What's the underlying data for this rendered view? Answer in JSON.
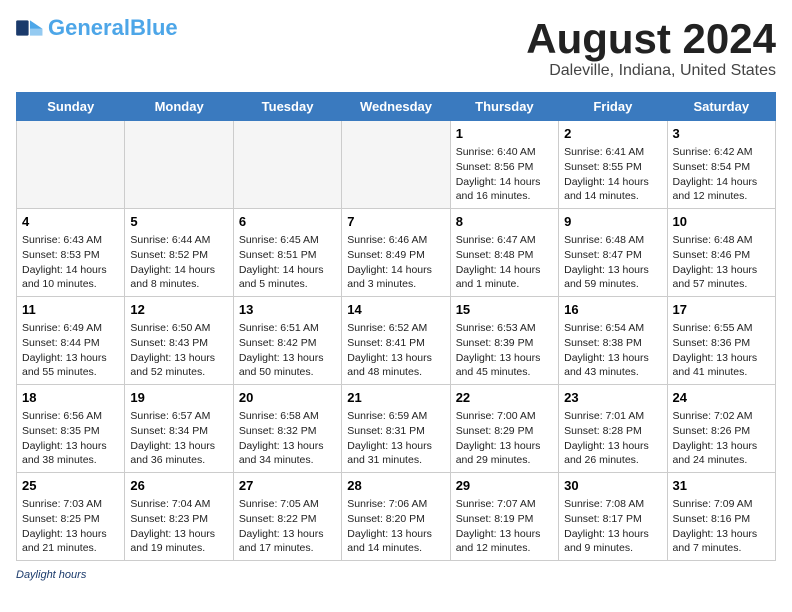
{
  "header": {
    "logo_line1": "General",
    "logo_line2": "Blue",
    "title": "August 2024",
    "subtitle": "Daleville, Indiana, United States"
  },
  "days_of_week": [
    "Sunday",
    "Monday",
    "Tuesday",
    "Wednesday",
    "Thursday",
    "Friday",
    "Saturday"
  ],
  "weeks": [
    [
      {
        "day": "",
        "info": ""
      },
      {
        "day": "",
        "info": ""
      },
      {
        "day": "",
        "info": ""
      },
      {
        "day": "",
        "info": ""
      },
      {
        "day": "1",
        "info": "Sunrise: 6:40 AM\nSunset: 8:56 PM\nDaylight: 14 hours and 16 minutes."
      },
      {
        "day": "2",
        "info": "Sunrise: 6:41 AM\nSunset: 8:55 PM\nDaylight: 14 hours and 14 minutes."
      },
      {
        "day": "3",
        "info": "Sunrise: 6:42 AM\nSunset: 8:54 PM\nDaylight: 14 hours and 12 minutes."
      }
    ],
    [
      {
        "day": "4",
        "info": "Sunrise: 6:43 AM\nSunset: 8:53 PM\nDaylight: 14 hours and 10 minutes."
      },
      {
        "day": "5",
        "info": "Sunrise: 6:44 AM\nSunset: 8:52 PM\nDaylight: 14 hours and 8 minutes."
      },
      {
        "day": "6",
        "info": "Sunrise: 6:45 AM\nSunset: 8:51 PM\nDaylight: 14 hours and 5 minutes."
      },
      {
        "day": "7",
        "info": "Sunrise: 6:46 AM\nSunset: 8:49 PM\nDaylight: 14 hours and 3 minutes."
      },
      {
        "day": "8",
        "info": "Sunrise: 6:47 AM\nSunset: 8:48 PM\nDaylight: 14 hours and 1 minute."
      },
      {
        "day": "9",
        "info": "Sunrise: 6:48 AM\nSunset: 8:47 PM\nDaylight: 13 hours and 59 minutes."
      },
      {
        "day": "10",
        "info": "Sunrise: 6:48 AM\nSunset: 8:46 PM\nDaylight: 13 hours and 57 minutes."
      }
    ],
    [
      {
        "day": "11",
        "info": "Sunrise: 6:49 AM\nSunset: 8:44 PM\nDaylight: 13 hours and 55 minutes."
      },
      {
        "day": "12",
        "info": "Sunrise: 6:50 AM\nSunset: 8:43 PM\nDaylight: 13 hours and 52 minutes."
      },
      {
        "day": "13",
        "info": "Sunrise: 6:51 AM\nSunset: 8:42 PM\nDaylight: 13 hours and 50 minutes."
      },
      {
        "day": "14",
        "info": "Sunrise: 6:52 AM\nSunset: 8:41 PM\nDaylight: 13 hours and 48 minutes."
      },
      {
        "day": "15",
        "info": "Sunrise: 6:53 AM\nSunset: 8:39 PM\nDaylight: 13 hours and 45 minutes."
      },
      {
        "day": "16",
        "info": "Sunrise: 6:54 AM\nSunset: 8:38 PM\nDaylight: 13 hours and 43 minutes."
      },
      {
        "day": "17",
        "info": "Sunrise: 6:55 AM\nSunset: 8:36 PM\nDaylight: 13 hours and 41 minutes."
      }
    ],
    [
      {
        "day": "18",
        "info": "Sunrise: 6:56 AM\nSunset: 8:35 PM\nDaylight: 13 hours and 38 minutes."
      },
      {
        "day": "19",
        "info": "Sunrise: 6:57 AM\nSunset: 8:34 PM\nDaylight: 13 hours and 36 minutes."
      },
      {
        "day": "20",
        "info": "Sunrise: 6:58 AM\nSunset: 8:32 PM\nDaylight: 13 hours and 34 minutes."
      },
      {
        "day": "21",
        "info": "Sunrise: 6:59 AM\nSunset: 8:31 PM\nDaylight: 13 hours and 31 minutes."
      },
      {
        "day": "22",
        "info": "Sunrise: 7:00 AM\nSunset: 8:29 PM\nDaylight: 13 hours and 29 minutes."
      },
      {
        "day": "23",
        "info": "Sunrise: 7:01 AM\nSunset: 8:28 PM\nDaylight: 13 hours and 26 minutes."
      },
      {
        "day": "24",
        "info": "Sunrise: 7:02 AM\nSunset: 8:26 PM\nDaylight: 13 hours and 24 minutes."
      }
    ],
    [
      {
        "day": "25",
        "info": "Sunrise: 7:03 AM\nSunset: 8:25 PM\nDaylight: 13 hours and 21 minutes."
      },
      {
        "day": "26",
        "info": "Sunrise: 7:04 AM\nSunset: 8:23 PM\nDaylight: 13 hours and 19 minutes."
      },
      {
        "day": "27",
        "info": "Sunrise: 7:05 AM\nSunset: 8:22 PM\nDaylight: 13 hours and 17 minutes."
      },
      {
        "day": "28",
        "info": "Sunrise: 7:06 AM\nSunset: 8:20 PM\nDaylight: 13 hours and 14 minutes."
      },
      {
        "day": "29",
        "info": "Sunrise: 7:07 AM\nSunset: 8:19 PM\nDaylight: 13 hours and 12 minutes."
      },
      {
        "day": "30",
        "info": "Sunrise: 7:08 AM\nSunset: 8:17 PM\nDaylight: 13 hours and 9 minutes."
      },
      {
        "day": "31",
        "info": "Sunrise: 7:09 AM\nSunset: 8:16 PM\nDaylight: 13 hours and 7 minutes."
      }
    ]
  ],
  "footer": {
    "label": "Daylight hours"
  }
}
